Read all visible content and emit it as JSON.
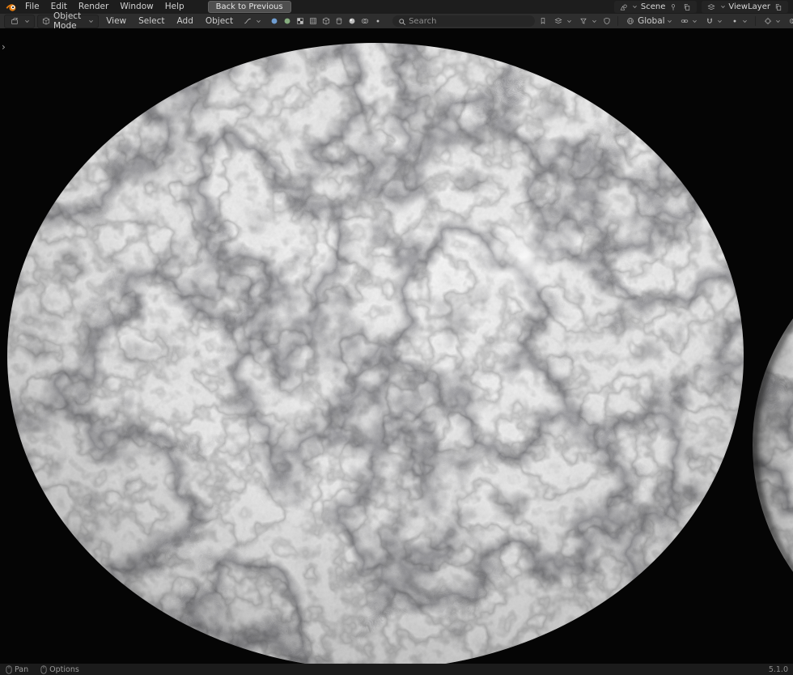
{
  "topbar": {
    "menus": [
      "File",
      "Edit",
      "Render",
      "Window",
      "Help"
    ],
    "back_button_label": "Back to Previous",
    "scene_label": "Scene",
    "viewlayer_label": "ViewLayer"
  },
  "viewport_header": {
    "mode_label": "Object Mode",
    "menus": [
      "View",
      "Select",
      "Add",
      "Object"
    ],
    "search_placeholder": "Search",
    "orientation_label": "Global"
  },
  "viewport": {
    "toolbar_toggle_glyph": "›"
  },
  "statusbar": {
    "pan_label": "Pan",
    "options_label": "Options",
    "version": "5.1.0"
  },
  "colors": {
    "accent_blue": "#4772b3",
    "blender_orange": "#e87d0d",
    "topbar_bg": "#1d1d1d",
    "header_bg": "#2e2e2e",
    "viewport_bg": "#050505",
    "statusbar_bg": "#1b1b1b"
  }
}
